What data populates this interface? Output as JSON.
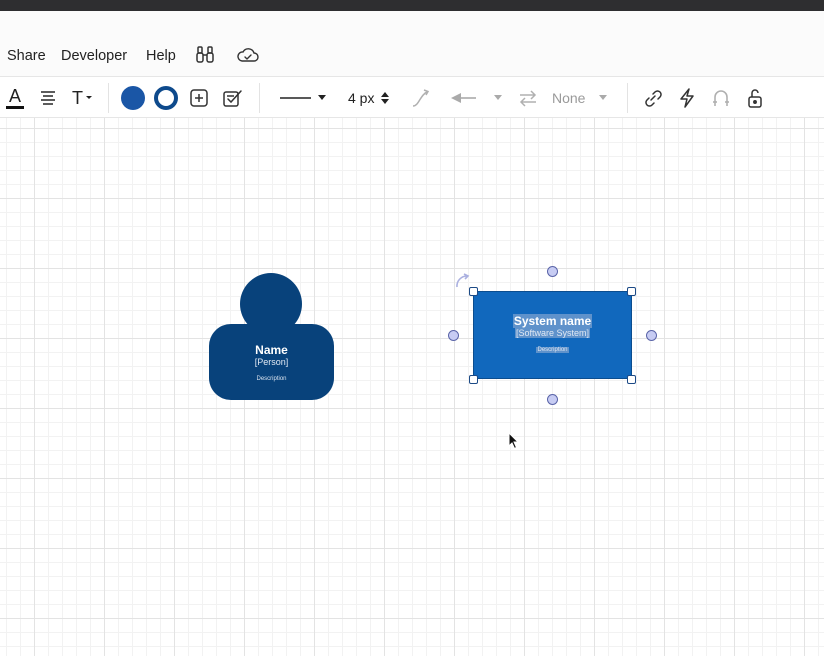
{
  "menu": {
    "share": "Share",
    "developer": "Developer",
    "help": "Help",
    "icons": [
      "binoculars-icon",
      "cloud-sync-icon"
    ]
  },
  "toolbar": {
    "font_color_icon": "font-color-icon",
    "text_align_icon": "text-align-icon",
    "text_size_icon": "text-size-icon",
    "fill_color": "#1a56a6",
    "line_color": "#0e4a8c",
    "stroke_width": "4 px",
    "arrow_style": "None"
  },
  "canvas": {
    "person": {
      "name": "Name",
      "type": "[Person]",
      "description": "Description",
      "color": "#08427b"
    },
    "system": {
      "name": "System name",
      "type": "[Software System]",
      "description": "Description",
      "color": "#1168bd"
    }
  }
}
